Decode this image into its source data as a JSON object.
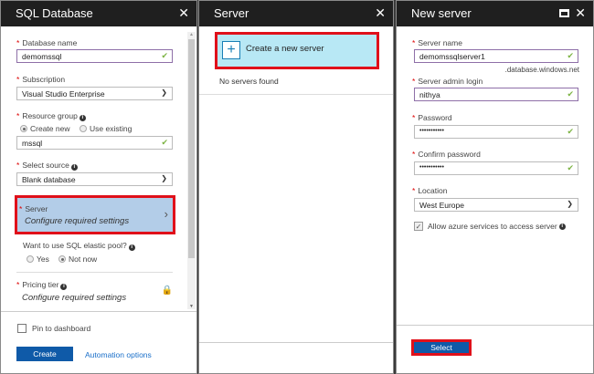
{
  "sql_panel": {
    "title": "SQL Database",
    "fields": {
      "db_name_label": "Database name",
      "db_name_value": "demomssql",
      "subscription_label": "Subscription",
      "subscription_value": "Visual Studio Enterprise",
      "rg_label": "Resource group",
      "rg_create_new": "Create new",
      "rg_use_existing": "Use existing",
      "rg_value": "mssql",
      "source_label": "Select source",
      "source_value": "Blank database",
      "server_label": "Server",
      "server_value": "Configure required settings",
      "elastic_label": "Want to use SQL elastic pool?",
      "elastic_yes": "Yes",
      "elastic_not_now": "Not now",
      "pricing_label": "Pricing tier",
      "pricing_value": "Configure required settings"
    },
    "pin_label": "Pin to dashboard",
    "create_label": "Create",
    "automation_label": "Automation options"
  },
  "server_panel": {
    "title": "Server",
    "create_label": "Create a new server",
    "empty_text": "No servers found"
  },
  "new_server_panel": {
    "title": "New server",
    "server_name_label": "Server name",
    "server_name_value": "demomssqlserver1",
    "domain_suffix": ".database.windows.net",
    "admin_label": "Server admin login",
    "admin_value": "nithya",
    "password_label": "Password",
    "password_value": "•••••••••••",
    "confirm_label": "Confirm password",
    "confirm_value": "•••••••••••",
    "location_label": "Location",
    "location_value": "West Europe",
    "allow_label": "Allow azure services to access server",
    "select_label": "Select"
  },
  "colors": {
    "header": "#1f1f1f",
    "accent": "#0f5aa8",
    "highlight_border": "#e0101a",
    "selected_bg": "#b3cde8",
    "create_bg": "#b8e8f5"
  }
}
